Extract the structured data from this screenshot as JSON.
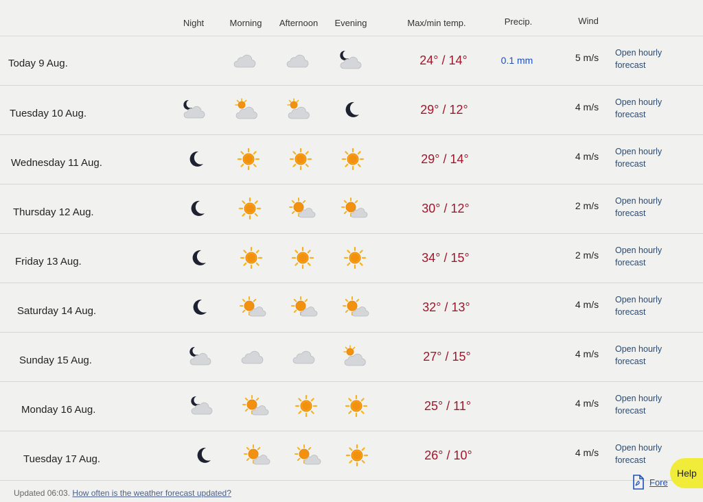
{
  "columns": {
    "night": "Night",
    "morning": "Morning",
    "afternoon": "Afternoon",
    "evening": "Evening",
    "temp": "Max/min temp.",
    "precip": "Precip.",
    "wind": "Wind"
  },
  "rows": [
    {
      "day": "Today 9 Aug.",
      "icons": [
        "none",
        "cloud",
        "cloud",
        "moon-cloud"
      ],
      "temp": "24° / 14°",
      "precip": "0.1 mm",
      "wind": "5 m/s",
      "hourly": "Open hourly forecast"
    },
    {
      "day": "Tuesday 10 Aug.",
      "icons": [
        "moon-cloud",
        "sun-cloud",
        "sun-cloud",
        "moon"
      ],
      "temp": "29° / 12°",
      "precip": "",
      "wind": "4 m/s",
      "hourly": "Open hourly forecast"
    },
    {
      "day": "Wednesday 11 Aug.",
      "icons": [
        "moon",
        "sun",
        "sun",
        "sun"
      ],
      "temp": "29° / 14°",
      "precip": "",
      "wind": "4 m/s",
      "hourly": "Open hourly forecast"
    },
    {
      "day": "Thursday 12 Aug.",
      "icons": [
        "moon",
        "sun",
        "sun-partly",
        "sun-partly"
      ],
      "temp": "30° / 12°",
      "precip": "",
      "wind": "2 m/s",
      "hourly": "Open hourly forecast"
    },
    {
      "day": "Friday 13 Aug.",
      "icons": [
        "moon",
        "sun",
        "sun",
        "sun"
      ],
      "temp": "34° / 15°",
      "precip": "",
      "wind": "2 m/s",
      "hourly": "Open hourly forecast"
    },
    {
      "day": "Saturday 14 Aug.",
      "icons": [
        "moon",
        "sun-partly",
        "sun-partly",
        "sun-partly"
      ],
      "temp": "32° / 13°",
      "precip": "",
      "wind": "4 m/s",
      "hourly": "Open hourly forecast"
    },
    {
      "day": "Sunday 15 Aug.",
      "icons": [
        "moon-cloud",
        "cloud",
        "cloud",
        "sun-cloud"
      ],
      "temp": "27° / 15°",
      "precip": "",
      "wind": "4 m/s",
      "hourly": "Open hourly forecast"
    },
    {
      "day": "Monday 16 Aug.",
      "icons": [
        "moon-cloud",
        "sun-partly",
        "sun",
        "sun"
      ],
      "temp": "25° / 11°",
      "precip": "",
      "wind": "4 m/s",
      "hourly": "Open hourly forecast"
    },
    {
      "day": "Tuesday 17 Aug.",
      "icons": [
        "moon",
        "sun-partly",
        "sun-partly",
        "sun"
      ],
      "temp": "26° / 10°",
      "precip": "",
      "wind": "4 m/s",
      "hourly": "Open hourly forecast"
    }
  ],
  "footer": {
    "updated": "Updated 06:03.",
    "faq_link": "How often is the weather forecast updated?",
    "pdf_link": "Fore",
    "help": "Help"
  },
  "colors": {
    "temp": "#a0172b",
    "precip": "#1f4fb8",
    "help_bg": "#f1ec3a"
  }
}
